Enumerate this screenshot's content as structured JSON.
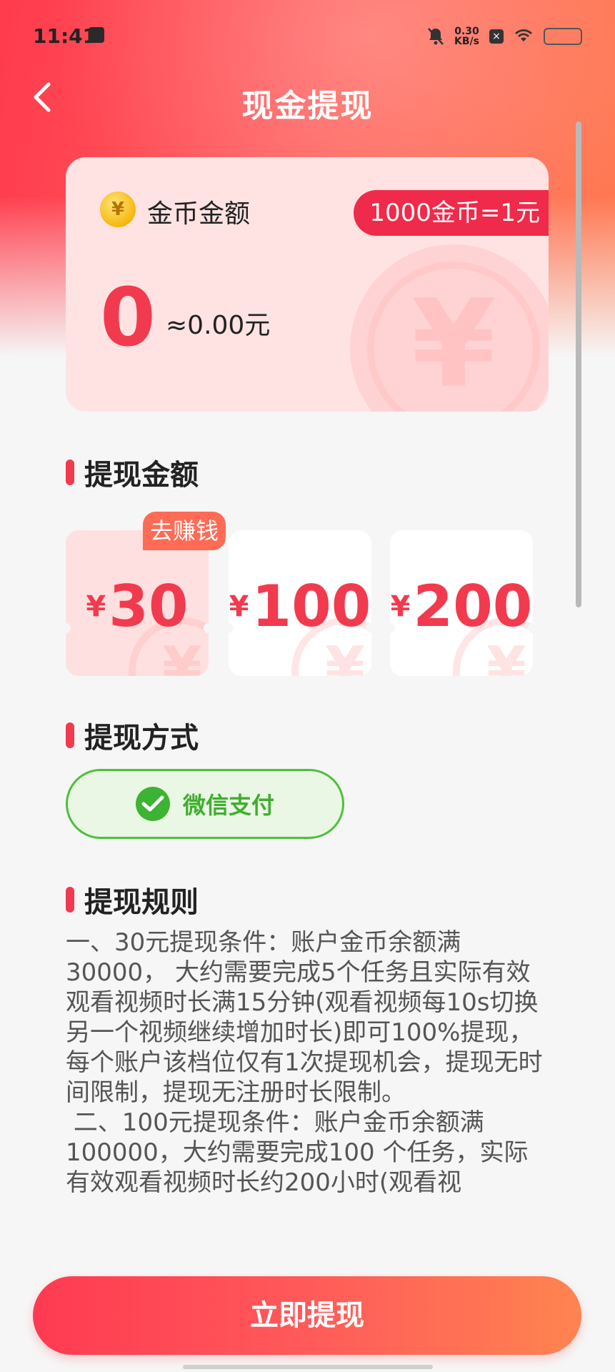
{
  "status_bar": {
    "time": "11:41",
    "net_speed_value": "0.30",
    "net_speed_unit": "KB/s",
    "icons": [
      "message-icon",
      "mute-icon",
      "sim-icon",
      "wifi-icon",
      "battery-icon"
    ]
  },
  "header": {
    "title": "现金提现",
    "back_icon": "chevron-left-icon"
  },
  "balance_card": {
    "label": "金币金额",
    "rate": "1000金币=1元",
    "coin_balance": "0",
    "cash_value": "≈0.00元",
    "coin_icon": "¥",
    "watermark_icon": "¥"
  },
  "amount_section": {
    "title": "提现金额",
    "earn_tag": "去赚钱",
    "currency_symbol": "¥",
    "options": [
      {
        "value": "30",
        "selected": true
      },
      {
        "value": "100",
        "selected": false
      },
      {
        "value": "200",
        "selected": false
      }
    ]
  },
  "method_section": {
    "title": "提现方式",
    "method_label": "微信支付",
    "method_icon": "wechat-pay-icon"
  },
  "rules_section": {
    "title": "提现规则",
    "text": "一、30元提现条件：账户金币余额满30000， 大约需要完成5个任务且实际有效观看视频时长满15分钟(观看视频每10s切换另一个视频继续增加时长)即可100%提现，每个账户该档位仅有1次提现机会，提现无时间限制，提现无注册时长限制。\n 二、100元提现条件：账户金币余额满100000，大约需要完成100 个任务，实际有效观看视频时长约200小时(观看视"
  },
  "actions": {
    "withdraw_label": "立即提现"
  },
  "colors": {
    "accent_red": "#f23a4f",
    "gradient_start": "#ff3a52",
    "gradient_end": "#ff8450",
    "wechat_green": "#3cb332"
  }
}
